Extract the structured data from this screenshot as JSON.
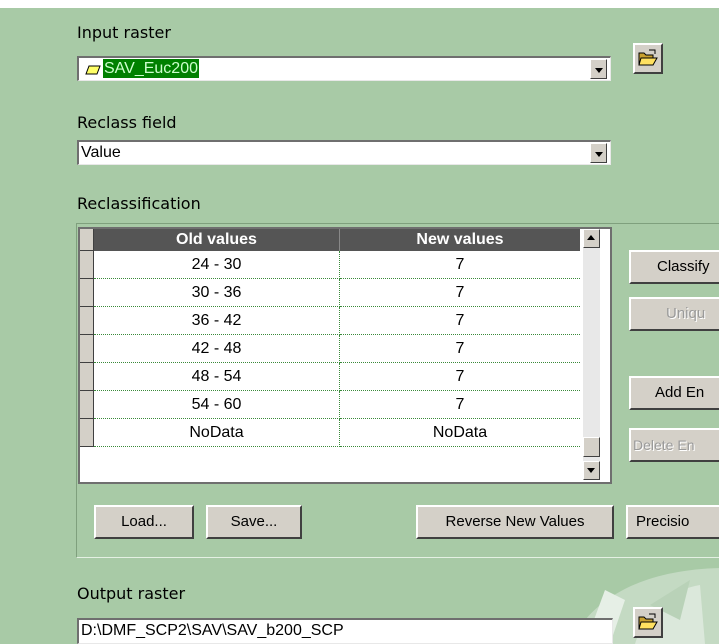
{
  "input_raster": {
    "label": "Input raster",
    "value": "SAV_Euc200",
    "layer_icon": "raster-layer-icon",
    "browse_icon": "open-folder-icon"
  },
  "reclass_field": {
    "label": "Reclass field",
    "value": "Value"
  },
  "reclassification": {
    "label": "Reclassification",
    "columns": [
      "Old values",
      "New values"
    ],
    "rows": [
      {
        "old": "24 - 30",
        "new": "7"
      },
      {
        "old": "30 - 36",
        "new": "7"
      },
      {
        "old": "36 - 42",
        "new": "7"
      },
      {
        "old": "42 - 48",
        "new": "7"
      },
      {
        "old": "48 - 54",
        "new": "7"
      },
      {
        "old": "54 - 60",
        "new": "7"
      },
      {
        "old": "NoData",
        "new": "NoData"
      }
    ],
    "buttons": {
      "classify": "Classify",
      "unique": "Uniqu",
      "add_entry": "Add En",
      "delete_entry": "Delete En",
      "precision": "Precisio",
      "load": "Load...",
      "save": "Save...",
      "reverse": "Reverse New Values"
    }
  },
  "output_raster": {
    "label": "Output raster",
    "value": "D:\\DMF_SCP2\\SAV\\SAV_b200_SCP",
    "browse_icon": "open-folder-icon"
  },
  "colors": {
    "background": "#a8caa6",
    "header": "#555555",
    "selection": "#008000",
    "selection_text": "#ccffcc"
  }
}
